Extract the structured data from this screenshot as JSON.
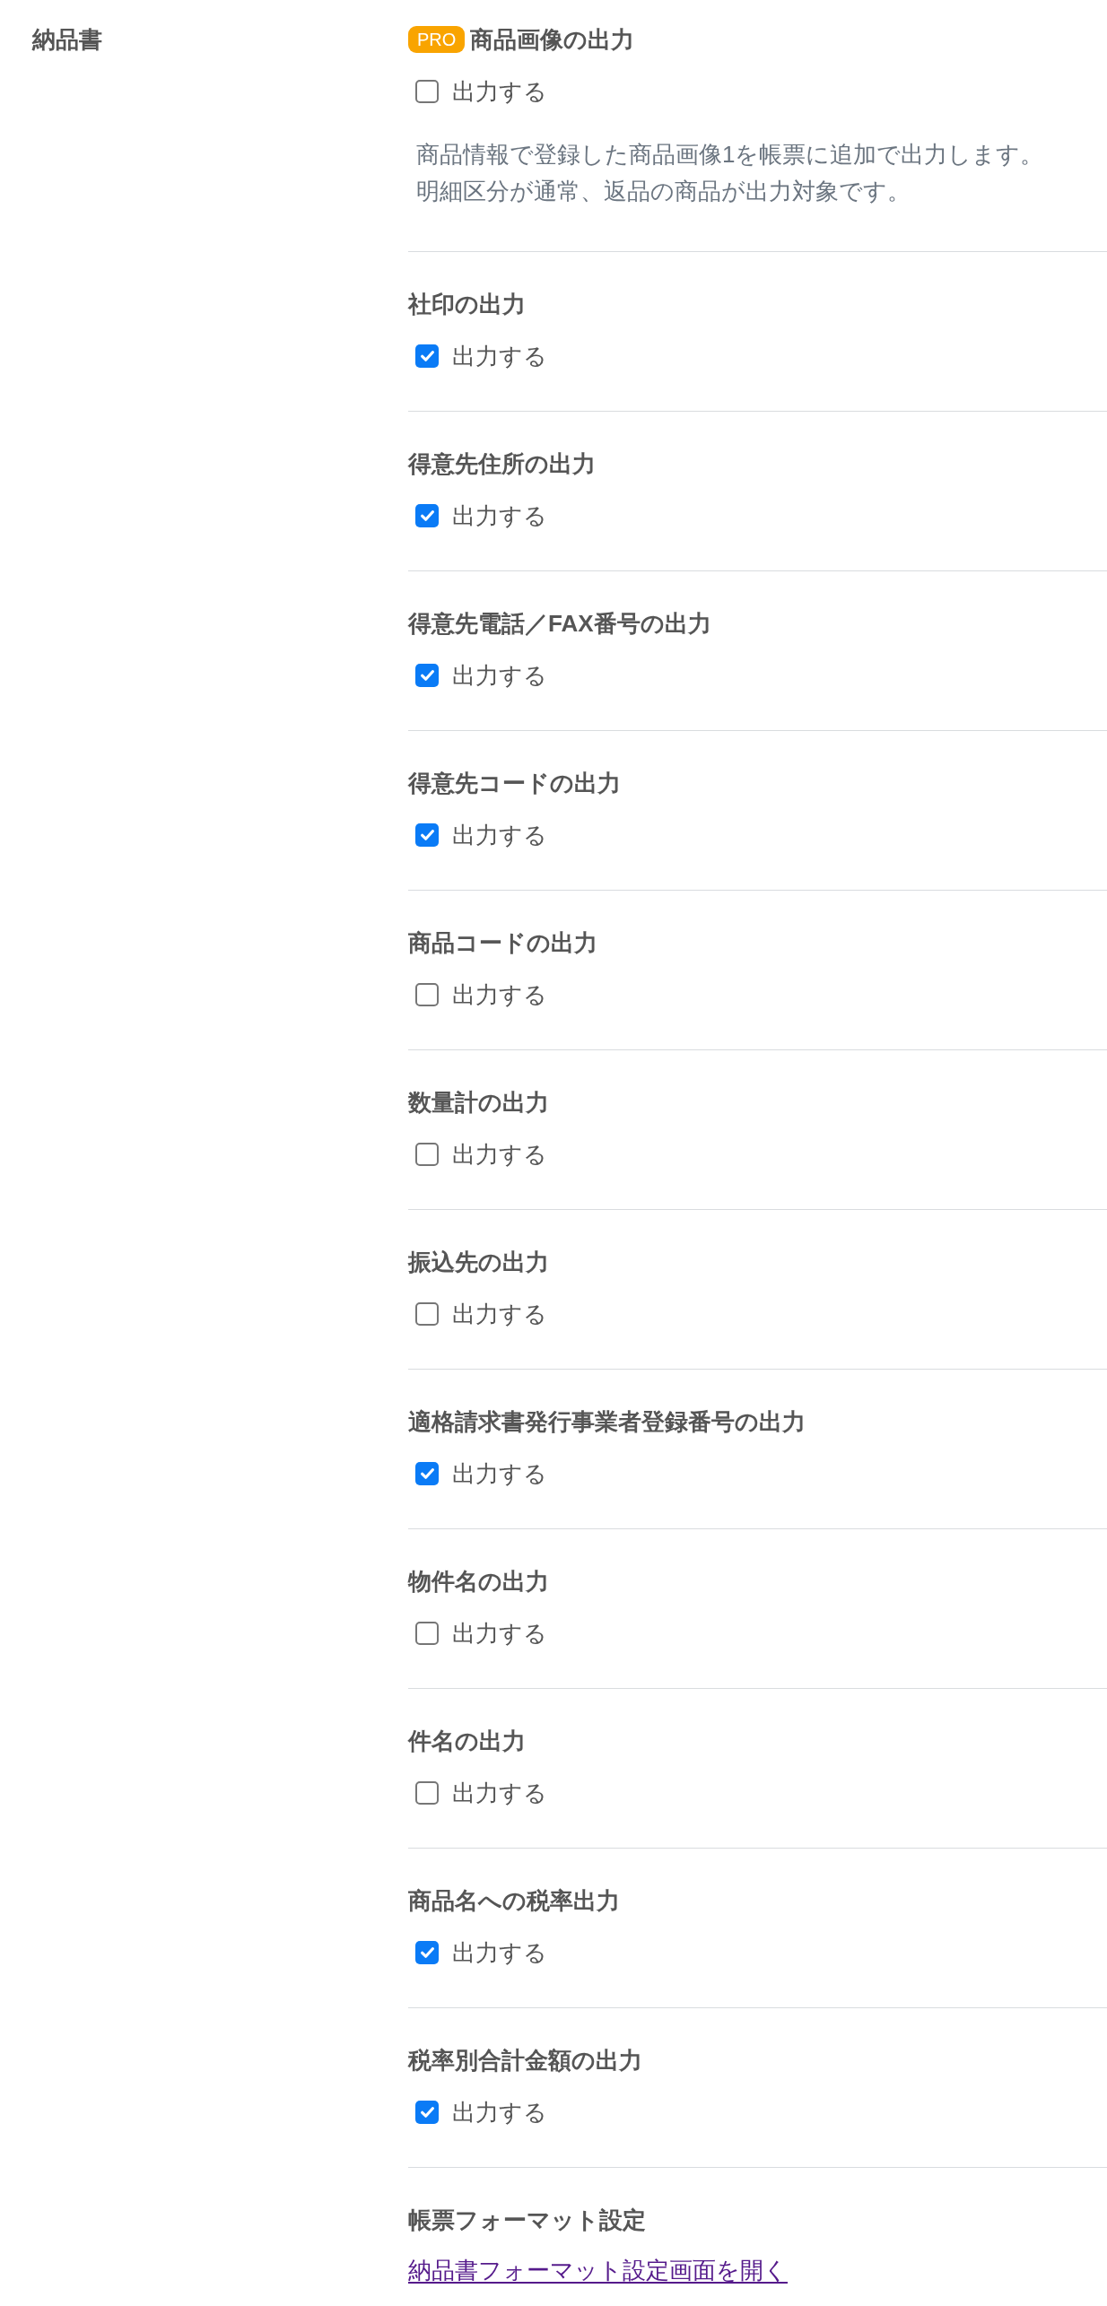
{
  "document": {
    "label": "納品書"
  },
  "settings": [
    {
      "kind": "checkbox",
      "badge": "PRO",
      "title": "商品画像の出力",
      "option": {
        "label": "出力する",
        "checked": false
      },
      "description": [
        "商品情報で登録した商品画像1を帳票に追加で出力します。",
        "明細区分が通常、返品の商品が出力対象です。"
      ]
    },
    {
      "kind": "checkbox",
      "title": "社印の出力",
      "option": {
        "label": "出力する",
        "checked": true
      }
    },
    {
      "kind": "checkbox",
      "title": "得意先住所の出力",
      "option": {
        "label": "出力する",
        "checked": true
      }
    },
    {
      "kind": "checkbox",
      "title": "得意先電話／FAX番号の出力",
      "option": {
        "label": "出力する",
        "checked": true
      }
    },
    {
      "kind": "checkbox",
      "title": "得意先コードの出力",
      "option": {
        "label": "出力する",
        "checked": true
      }
    },
    {
      "kind": "checkbox",
      "title": "商品コードの出力",
      "option": {
        "label": "出力する",
        "checked": false
      }
    },
    {
      "kind": "checkbox",
      "title": "数量計の出力",
      "option": {
        "label": "出力する",
        "checked": false
      }
    },
    {
      "kind": "checkbox",
      "title": "振込先の出力",
      "option": {
        "label": "出力する",
        "checked": false
      }
    },
    {
      "kind": "checkbox",
      "title": "適格請求書発行事業者登録番号の出力",
      "option": {
        "label": "出力する",
        "checked": true
      }
    },
    {
      "kind": "checkbox",
      "title": "物件名の出力",
      "option": {
        "label": "出力する",
        "checked": false
      }
    },
    {
      "kind": "checkbox",
      "title": "件名の出力",
      "option": {
        "label": "出力する",
        "checked": false
      }
    },
    {
      "kind": "checkbox",
      "title": "商品名への税率出力",
      "option": {
        "label": "出力する",
        "checked": true
      }
    },
    {
      "kind": "checkbox",
      "title": "税率別合計金額の出力",
      "option": {
        "label": "出力する",
        "checked": true
      }
    },
    {
      "kind": "link",
      "title": "帳票フォーマット設定",
      "link": "納品書フォーマット設定画面を開く"
    }
  ]
}
